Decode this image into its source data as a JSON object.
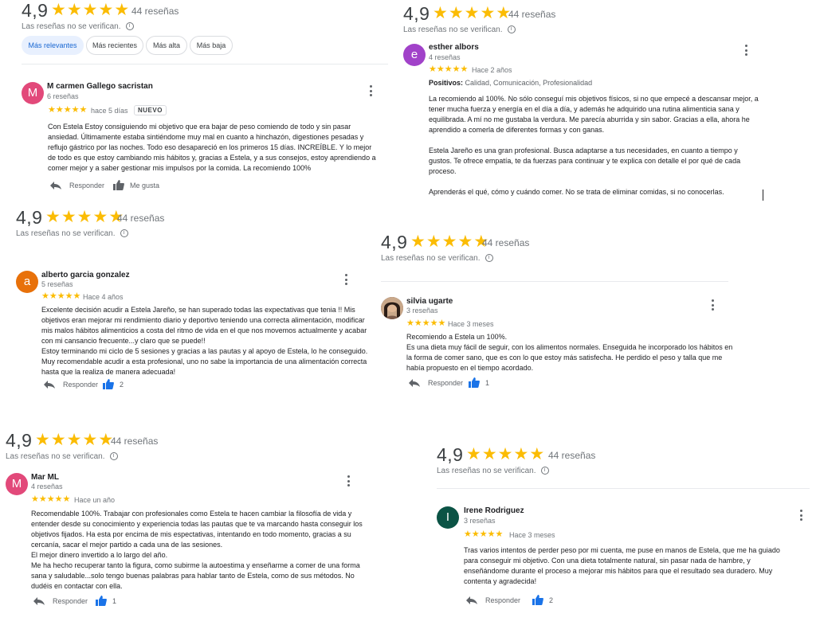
{
  "summary": {
    "rating": "4,9",
    "reviews_count": "44 reseñas",
    "unverified": "Las reseñas no se verifican.",
    "star_color": "#fbbc04"
  },
  "filters": [
    {
      "label": "Más relevantes",
      "active": true
    },
    {
      "label": "Más recientes",
      "active": false
    },
    {
      "label": "Más alta",
      "active": false
    },
    {
      "label": "Más baja",
      "active": false
    }
  ],
  "actions": {
    "reply": "Responder",
    "like": "Me gusta"
  },
  "reviews": [
    {
      "name": "M carmen Gallego sacristan",
      "count": "6 reseñas",
      "initial": "M",
      "avatar_color": "#e2497a",
      "time": "hace 5 días",
      "badge": "NUEVO",
      "rating": 5,
      "text": "Con Estela Estoy consiguiendo mi objetivo que era bajar de peso comiendo de todo y sin pasar\nansiedad. Últimamente estaba sintiéndome muy mal en cuanto a hinchazón, digestiones pesadas y\nreflujo gástrico por las noches. Todo eso desapareció en los primeros 15 días. INCREÍBLE. Y lo mejor\nde todo es que estoy cambiando mis hábitos y, gracias a Estela, y a sus consejos, estoy aprendiendo a\ncomer mejor y a saber gestionar mis impulsos por la comida. La recomiendo 100%",
      "likes": ""
    },
    {
      "name": "esther albors",
      "count": "4 reseñas",
      "initial": "e",
      "avatar_color": "#a142c9",
      "time": "Hace 2 años",
      "rating": 5,
      "positives_label": "Positivos:",
      "positives": "Calidad, Comunicación, Profesionalidad",
      "text": "La recomiendo al 100%.  No sólo conseguí mis objetivos físicos, si no que empecé a descansar mejor, a\ntener mucha fuerza y energía en el día a día, y además  he adquirido una rutina alimenticia sana y\nequilibrada. A mí no me gustaba la verdura. Me parecía aburrida y sin sabor. Gracias a ella, ahora he\naprendido a comerla de diferentes formas y con ganas.\n\nEstela Jareño es una gran profesional. Busca adaptarse a tus necesidades, en cuanto a tiempo y\ngustos. Te ofrece empatía, te da fuerzas para continuar y te explica con detalle el por qué de cada\nproceso.\n\nAprenderás el qué, cómo y cuándo comer. No se trata de eliminar comidas, si no conocerlas."
    },
    {
      "name": "alberto garcia gonzalez",
      "count": "5 reseñas",
      "initial": "a",
      "avatar_color": "#e8710a",
      "time": "Hace 4 años",
      "rating": 5,
      "text": "Excelente decisión acudir a Estela Jareño, se han superado todas las expectativas que tenia !! Mis\nobjetivos eran mejorar mi rendimiento diario y deportivo teniendo una correcta alimentación, modificar\nmis malos hábitos alimenticios a costa del ritmo de vida en el que nos movemos actualmente y acabar\ncon mi cansancio frecuente...y claro que se puede!!\nEstoy terminando mi ciclo de 5 sesiones y gracias a las pautas y al apoyo de Estela, lo he conseguido.\nMuy recomendable acudir a esta profesional, uno no sabe la importancia de una alimentación correcta\nhasta que la realiza de manera adecuada!",
      "likes": "2"
    },
    {
      "name": "silvia ugarte",
      "count": "3 reseñas",
      "initial": "",
      "avatar_color": "#5d4037",
      "time": "Hace 3 meses",
      "rating": 5,
      "text": "Recomiendo a Estela un 100%.\nEs una dieta muy fácil de seguir, con los alimentos normales. Enseguida he incorporado los hábitos en\nla forma de comer sano, que es con lo que estoy más satisfecha. He perdido el peso y talla que me\nhabía propuesto en el tiempo acordado.",
      "likes": "1"
    },
    {
      "name": "Mar ML",
      "count": "4 reseñas",
      "initial": "M",
      "avatar_color": "#e2497a",
      "time": "Hace un año",
      "rating": 5,
      "text": "Recomendable 100%. Trabajar con profesionales como Estela te hacen cambiar la filosofía de vida y\nentender desde su conocimiento y experiencia todas las pautas que te va marcando hasta conseguir los\nobjetivos fijados. Ha esta por encima de mis espectativas, intentando en todo momento, gracias a su\ncercanía, sacar el mejor partido a cada una de las sesiones.\nEl mejor dinero invertido a lo largo del año.\nMe ha hecho recuperar tanto la figura, como subirme la autoestima y enseñarme a comer de una forma\nsana y saludable...solo tengo buenas palabras para hablar tanto de Estela, como de sus métodos. No\ndudéis en contactar con ella.",
      "likes": "1"
    },
    {
      "name": "Irene Rodriguez",
      "count": "3 reseñas",
      "initial": "I",
      "avatar_color": "#0b5345",
      "time": "Hace 3 meses",
      "rating": 5,
      "text": "Tras varios intentos de perder peso por mi cuenta, me puse en manos de Estela, que me ha guiado\npara conseguir mi objetivo. Con una dieta totalmente natural, sin pasar nada de hambre, y\nenseñándome durante el proceso a mejorar mis hábitos para que el resultado sea duradero. Muy\ncontenta y agradecida!",
      "likes": "2"
    }
  ]
}
